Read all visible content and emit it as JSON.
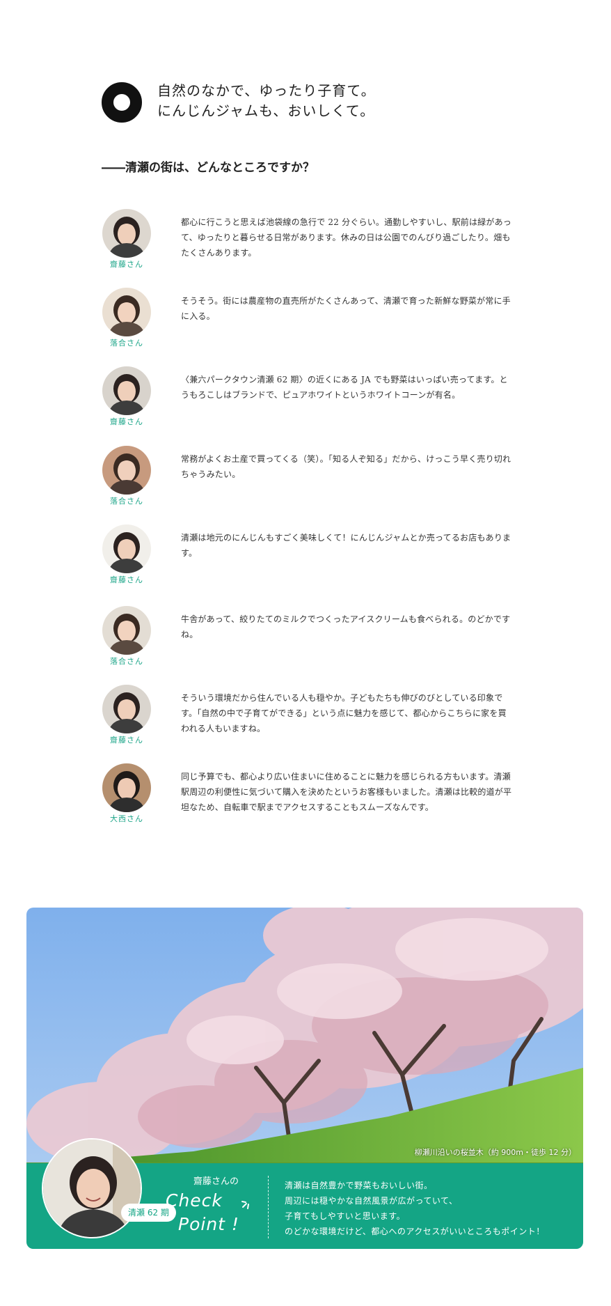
{
  "heading": {
    "title_lines": [
      "自然のなかで、ゆったり子育て。",
      "にんじんジャムも、おいしくて。"
    ],
    "question": "――清瀬の街は、どんなところですか？"
  },
  "conversation": [
    {
      "speaker": "齋藤さん",
      "text": "都心に行こうと思えば池袋線の急行で 22 分ぐらい。通勤しやすいし、駅前は緑があって、ゆったりと暮らせる日常があります。休みの日は公園でのんびり過ごしたり。畑もたくさんあります。"
    },
    {
      "speaker": "落合さん",
      "text": "そうそう。街には農産物の直売所がたくさんあって、清瀬で育った新鮮な野菜が常に手に入る。"
    },
    {
      "speaker": "齋藤さん",
      "text": "〈兼六パークタウン清瀬 62 期〉の近くにある JA でも野菜はいっぱい売ってます。とうもろこしはブランドで、ピュアホワイトというホワイトコーンが有名。"
    },
    {
      "speaker": "落合さん",
      "text": "常務がよくお土産で買ってくる（笑）。「知る人ぞ知る」だから、けっこう早く売り切れちゃうみたい。"
    },
    {
      "speaker": "齋藤さん",
      "text": "清瀬は地元のにんじんもすごく美味しくて！にんじんジャムとか売ってるお店もあります。"
    },
    {
      "speaker": "落合さん",
      "text": "牛舎があって、絞りたてのミルクでつくったアイスクリームも食べられる。のどかですね。"
    },
    {
      "speaker": "齋藤さん",
      "text": "そういう環境だから住んでいる人も穏やか。子どもたちも伸びのびとしている印象です。「自然の中で子育てができる」という点に魅力を感じて、都心からこちらに家を買われる人もいますね。"
    },
    {
      "speaker": "大西さん",
      "text": "同じ予算でも、都心より広い住まいに住めることに魅力を感じられる方もいます。清瀬駅周辺の利便性に気づいて購入を決めたというお客様もいました。清瀬は比較的道が平坦なため、自転車で駅までアクセスすることもスムーズなんです。"
    }
  ],
  "checkpoint": {
    "photo_caption": "柳瀬川沿いの桜並木（約 900m・徒歩 12 分）",
    "badge": "清瀬 62 期",
    "name": "齋藤さんの",
    "check": "Check",
    "point": "Point !",
    "lines": [
      "清瀬は自然豊かで野菜もおいしい街。",
      "周辺には穏やかな自然風景が広がっていて、",
      "子育てもしやすいと思います。",
      "のどかな環境だけど、都心へのアクセスがいいところもポイント！"
    ]
  },
  "colors": {
    "accent_green": "#14a585",
    "speaker_green": "#1fa68a",
    "ring_black": "#111111"
  }
}
